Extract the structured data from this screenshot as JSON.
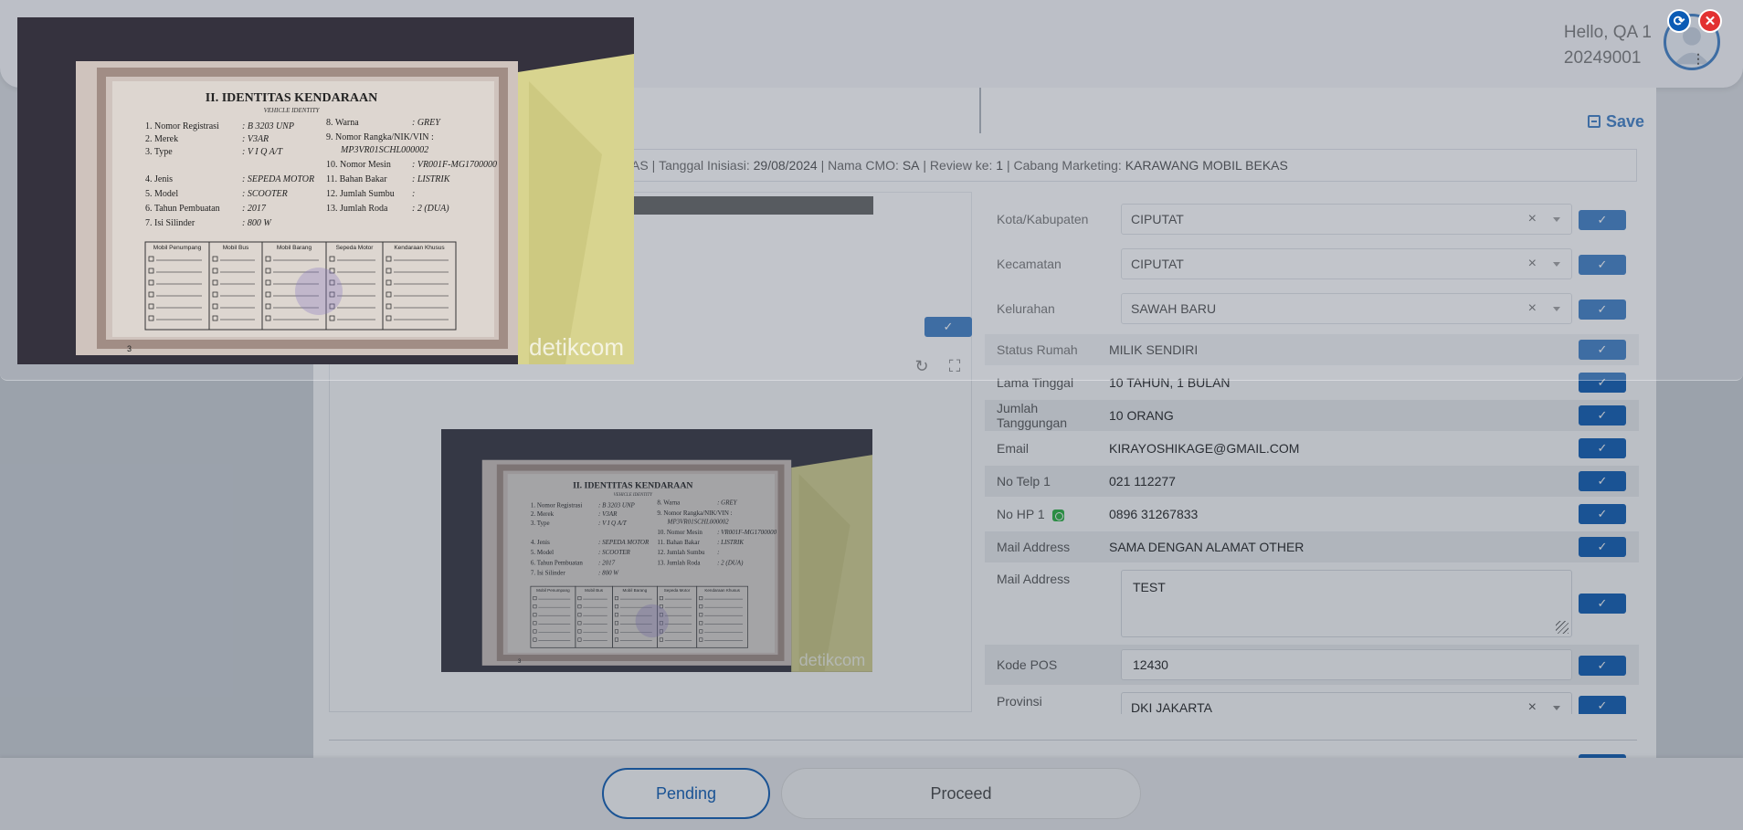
{
  "header": {
    "greeting": "Hello, QA 1",
    "user_id": "20249001"
  },
  "toolbar": {
    "save_label": "Save"
  },
  "info_bar": {
    "partial_prefix": "AS",
    "tanggal_label": "Tanggal Inisiasi:",
    "tanggal_value": "29/08/2024",
    "cmo_label": "Nama CMO:",
    "cmo_value": "SA",
    "review_label": "Review ke:",
    "review_value": "1",
    "cabang_label": "Cabang Marketing:",
    "cabang_value": "KARAWANG MOBIL BEKAS"
  },
  "document_image": {
    "heading": "II. IDENTITAS KENDARAAN",
    "subheading": "VEHICLE IDENTITY",
    "watermark": "detikcom",
    "page_number": "3",
    "fields_left": [
      {
        "num": "1.",
        "label": "Nomor Registrasi",
        "value": ": B 3203 UNP"
      },
      {
        "num": "2.",
        "label": "Merek",
        "value": ": V3AR"
      },
      {
        "num": "3.",
        "label": "Type",
        "value": ": V I Q A/T"
      },
      {
        "num": "4.",
        "label": "Jenis",
        "value": ": SEPEDA MOTOR"
      },
      {
        "num": "5.",
        "label": "Model",
        "value": ": SCOOTER"
      },
      {
        "num": "6.",
        "label": "Tahun Pembuatan",
        "value": ": 2017"
      },
      {
        "num": "7.",
        "label": "Isi Silinder",
        "value": ": 800 W"
      }
    ],
    "fields_right": [
      {
        "num": "8.",
        "label": "Warna",
        "value": ": GREY"
      },
      {
        "num": "9.",
        "label": "Nomor Rangka/NIK/VIN :",
        "value": "MP3VR01SCHL000002"
      },
      {
        "num": "10.",
        "label": "Nomor Mesin",
        "value": ": VR001F-MG1700000"
      },
      {
        "num": "11.",
        "label": "Bahan Bakar",
        "value": ": LISTRIK"
      },
      {
        "num": "12.",
        "label": "Jumlah Sumbu",
        "value": ":"
      },
      {
        "num": "13.",
        "label": "Jumlah Roda",
        "value": ": 2 (DUA)"
      }
    ],
    "table_headers": [
      "Mobil Penumpang",
      "Mobil Bus",
      "Mobil Barang",
      "Sepeda Motor",
      "Kendaraan Khusus"
    ]
  },
  "form": {
    "rows": [
      {
        "label": "Kota/Kabupaten",
        "value": "CIPUTAT",
        "type": "select"
      },
      {
        "label": "Kecamatan",
        "value": "CIPUTAT",
        "type": "select"
      },
      {
        "label": "Kelurahan",
        "value": "SAWAH BARU",
        "type": "select"
      },
      {
        "label": "Status Rumah",
        "value": "MILIK SENDIRI",
        "type": "text"
      },
      {
        "label": "Lama Tinggal",
        "value": "10 TAHUN, 1 BULAN",
        "type": "text"
      },
      {
        "label": "Jumlah Tanggungan",
        "value": "10 ORANG",
        "type": "text"
      },
      {
        "label": "Email",
        "value": "KIRAYOSHIKAGE@GMAIL.COM",
        "type": "text"
      },
      {
        "label": "No Telp 1",
        "value": "021 112277",
        "type": "text"
      },
      {
        "label": "No HP 1",
        "value": "0896 31267833",
        "type": "text"
      },
      {
        "label": "Mail Address",
        "value": "SAMA DENGAN ALAMAT OTHER",
        "type": "text"
      },
      {
        "label": "Mail Address",
        "value": "TEST",
        "type": "textarea"
      },
      {
        "label": "Kode POS",
        "value": "12430",
        "type": "input"
      },
      {
        "label": "Provinsi",
        "value": "DKI JAKARTA",
        "type": "select"
      }
    ],
    "clear_glyph": "×",
    "check_glyph": "✓"
  },
  "footer": {
    "pending_label": "Pending",
    "proceed_label": "Proceed"
  },
  "overlay": {
    "reload_glyph": "⟳",
    "close_glyph": "✕"
  },
  "colors": {
    "accent": "#0b5bb5",
    "close": "#e23131",
    "whatsapp": "#27b43e"
  }
}
